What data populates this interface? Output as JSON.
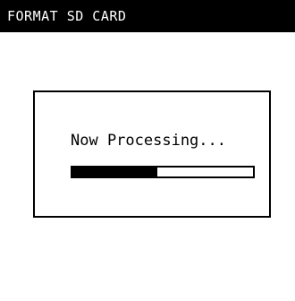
{
  "header": {
    "title": "FORMAT SD CARD"
  },
  "dialog": {
    "message": "Now Processing...",
    "progress": 0.47
  },
  "colors": {
    "background": "#ffffff",
    "foreground": "#000000",
    "title_text": "#ffffff"
  }
}
